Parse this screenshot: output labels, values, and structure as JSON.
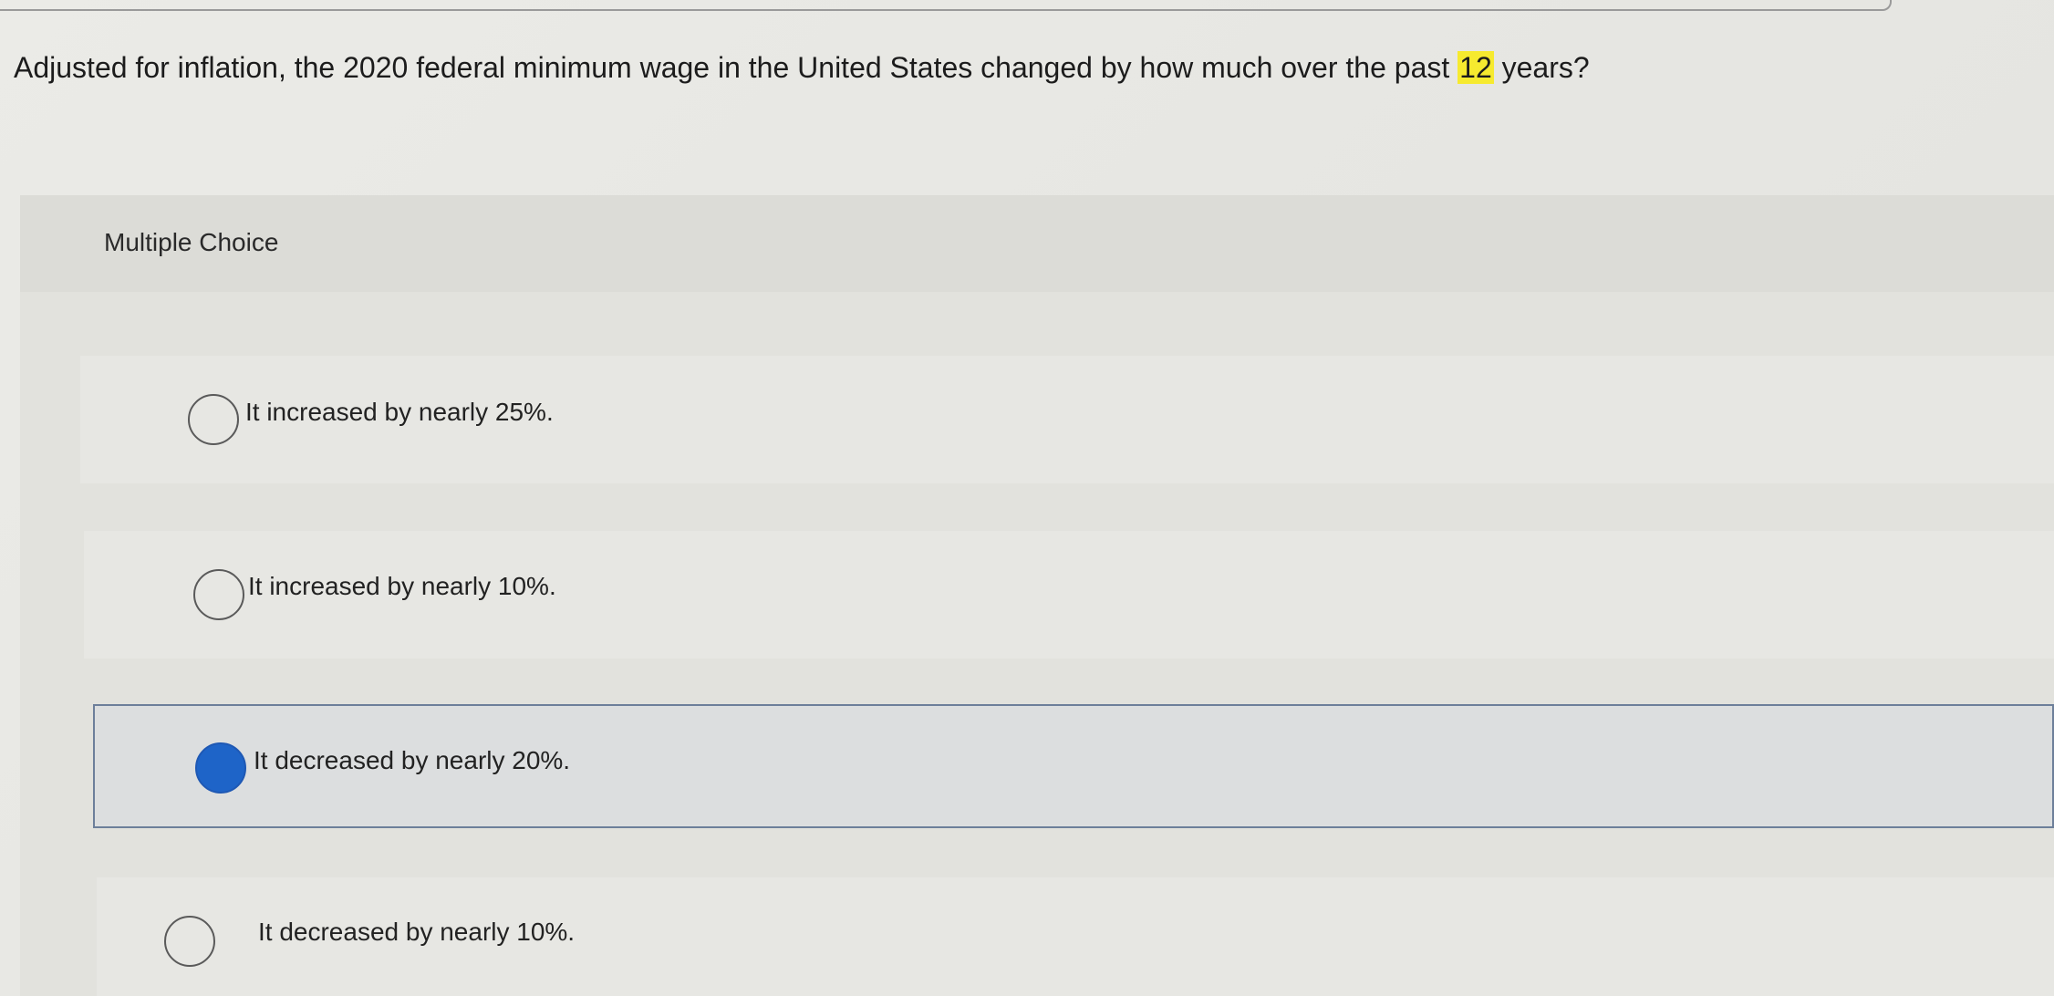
{
  "question": {
    "text_before": "Adjusted for inflation, the 2020 federal minimum wage in the United States changed by how much over the past ",
    "highlight": "12",
    "text_after": " years?"
  },
  "multiple_choice": {
    "label": "Multiple Choice",
    "options": [
      {
        "label": "It increased by nearly 25%.",
        "selected": false
      },
      {
        "label": "It increased by nearly 10%.",
        "selected": false
      },
      {
        "label": "It decreased by nearly 20%.",
        "selected": true
      },
      {
        "label": "It decreased by nearly 10%.",
        "selected": false
      }
    ]
  },
  "colors": {
    "highlight": "#f6ea2f",
    "selected_radio": "#1e64c8",
    "selected_border": "#6d7f9a"
  }
}
